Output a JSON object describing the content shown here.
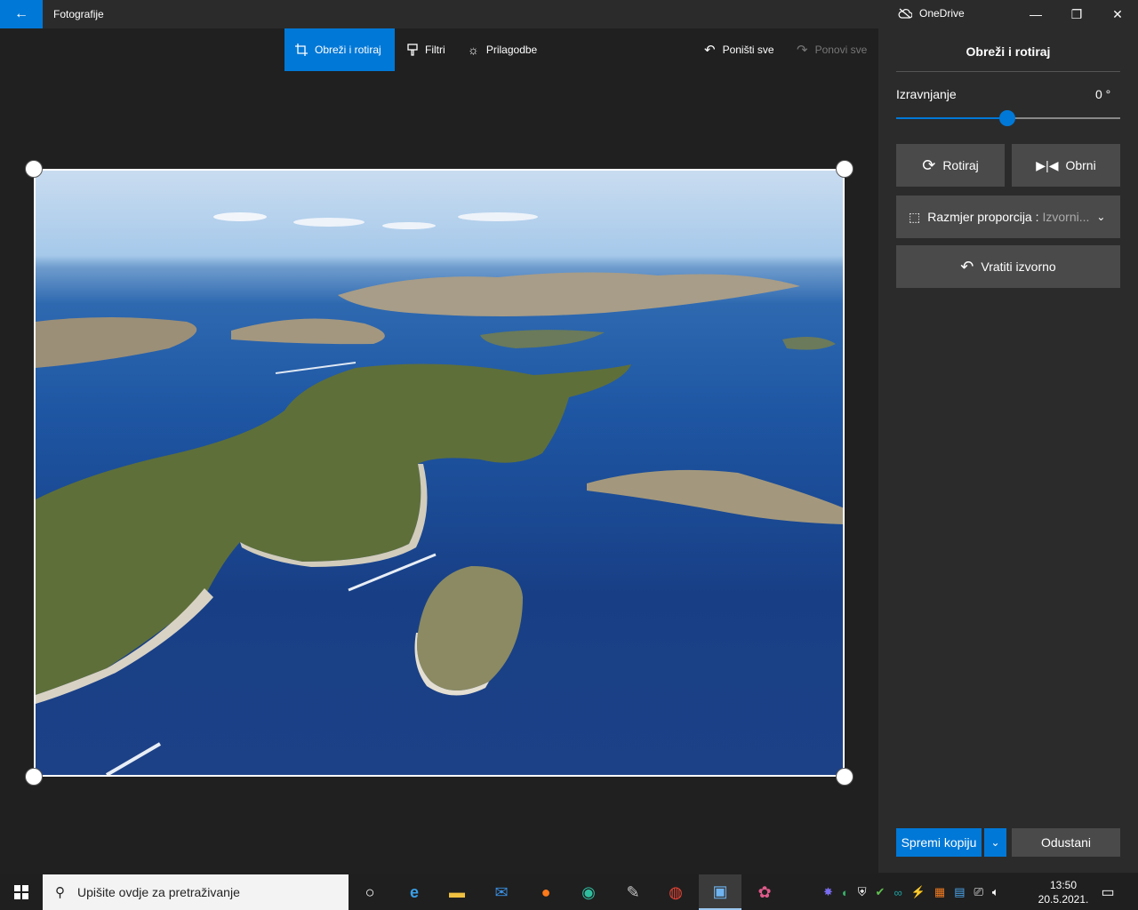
{
  "titlebar": {
    "app_title": "Fotografije",
    "onedrive_label": "OneDrive"
  },
  "toolbar": {
    "crop_rotate": "Obreži i rotiraj",
    "filters": "Filtri",
    "adjustments": "Prilagodbe",
    "undo_all": "Poništi sve",
    "redo_all": "Ponovi sve"
  },
  "panel": {
    "title": "Obreži i rotiraj",
    "straighten_label": "Izravnjanje",
    "straighten_value": "0 °",
    "straighten_level": 0.5,
    "rotate": "Rotiraj",
    "flip": "Obrni",
    "aspect_ratio": "Razmjer proporcija :",
    "aspect_ratio_value": "Izvorni...",
    "reset": "Vratiti izvorno",
    "save_copy": "Spremi kopiju",
    "cancel": "Odustani"
  },
  "taskbar": {
    "search_placeholder": "Upišite ovdje za pretraživanje",
    "time": "13:50",
    "date": "20.5.2021."
  },
  "colors": {
    "accent": "#0078d7",
    "panel_bg": "#2b2b2b",
    "canvas_bg": "#202020"
  }
}
